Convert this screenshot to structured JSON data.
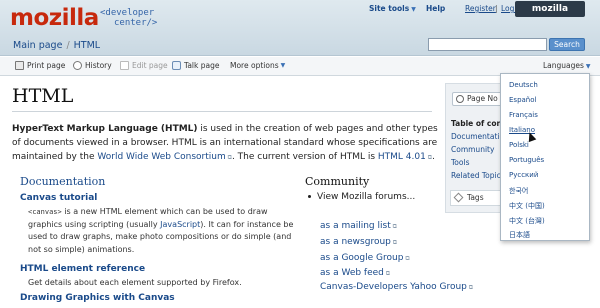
{
  "header": {
    "logo": "mozilla",
    "logo_sub_1": "<developer",
    "logo_sub_2": "center/>",
    "site_tools": "Site tools",
    "help": "Help",
    "register": "Register",
    "sep": "|",
    "login": "Log in",
    "mozilla_tab": "mozilla"
  },
  "breadcrumb": {
    "main_page": "Main page",
    "sep": "/",
    "current": "HTML"
  },
  "search": {
    "button": "Search",
    "placeholder": ""
  },
  "toolbar": {
    "print": "Print page",
    "history": "History",
    "edit": "Edit page",
    "talk": "Talk page",
    "more": "More options",
    "languages": "Languages"
  },
  "page": {
    "title": "HTML",
    "intro_bold": "HyperText Markup Language (HTML)",
    "intro_1": " is used in the creation of web pages and other types of documents viewed in a browser. HTML is an international standard whose specifications are maintained by the ",
    "intro_link_1": "World Wide Web Consortium",
    "intro_2": ". The current version of HTML is ",
    "intro_link_2": "HTML 4.01",
    "intro_3": "."
  },
  "documentation": {
    "heading": "Documentation",
    "items": [
      {
        "title": "Canvas tutorial",
        "code": "<canvas>",
        "text_a": " is a new HTML element which can be used to draw graphics using scripting (usually ",
        "link": "JavaScript",
        "text_b": "). It can for instance be used to draw graphs, make photo compositions or do simple (and not so simple) animations."
      },
      {
        "title": "HTML element reference",
        "text": "Get details about each element supported by Firefox."
      },
      {
        "title": "Drawing Graphics with Canvas"
      }
    ]
  },
  "community": {
    "heading": "Community",
    "intro": "View Mozilla forums...",
    "links": [
      "as a mailing list",
      "as a newsgroup",
      "as a Google Group",
      "as a Web feed",
      "Canvas-Developers Yahoo Group"
    ]
  },
  "sidebar": {
    "page_no": "Page No",
    "toc_title": "Table of conte",
    "toc": [
      "Documentation",
      "Community",
      "Tools",
      "Related Topics"
    ],
    "tags": "Tags"
  },
  "languages": [
    "Deutsch",
    "Español",
    "Français",
    "Italiano",
    "Polski",
    "Português",
    "Русский",
    "한국어",
    "中文 (中国)",
    "中文 (台灣)",
    "日本語"
  ],
  "colors": {
    "brand": "#c7290d",
    "link": "#1a4a8a",
    "button": "#5a90cc"
  }
}
